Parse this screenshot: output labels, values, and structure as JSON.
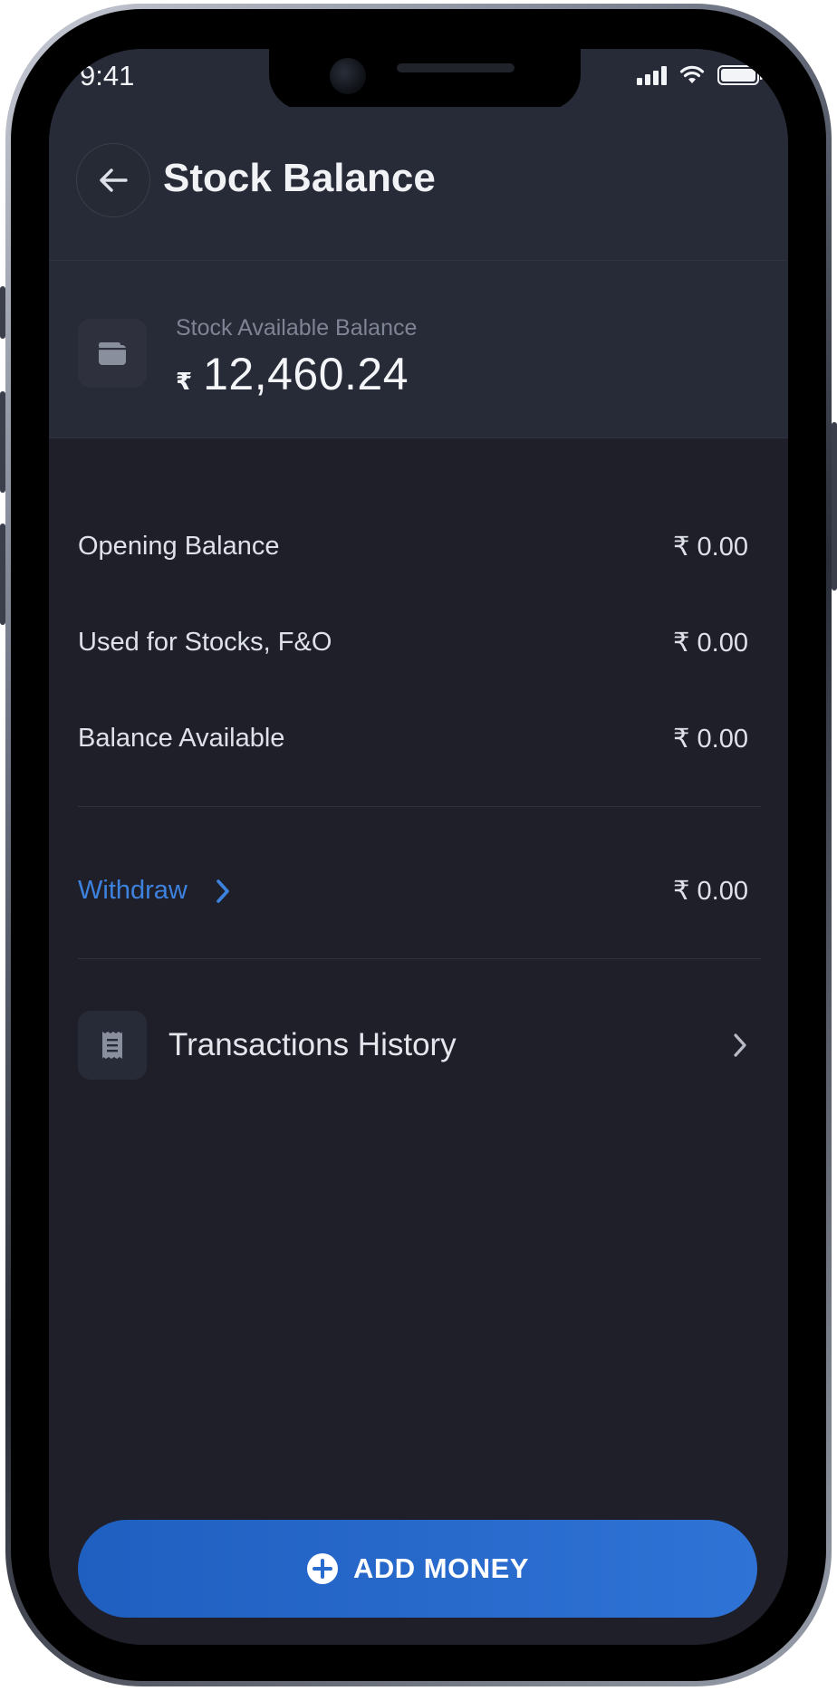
{
  "status_bar": {
    "time": "9:41"
  },
  "header": {
    "title": "Stock Balance"
  },
  "balance": {
    "label": "Stock Available Balance",
    "currency": "₹",
    "amount": "12,460.24"
  },
  "rows": [
    {
      "label": "Opening Balance",
      "value": "₹ 0.00"
    },
    {
      "label": "Used for Stocks, F&O",
      "value": "₹ 0.00"
    },
    {
      "label": "Balance Available",
      "value": "₹ 0.00"
    }
  ],
  "withdraw": {
    "label": "Withdraw",
    "value": "₹ 0.00"
  },
  "transactions": {
    "label": "Transactions History"
  },
  "cta": {
    "label": "ADD MONEY"
  },
  "colors": {
    "background": "#1f1f2a",
    "surface": "#272a37",
    "accent": "#2f73d6",
    "link": "#3d82de"
  },
  "icons": [
    "back-arrow-icon",
    "wallet-icon",
    "chevron-right-icon",
    "receipt-icon",
    "plus-circle-icon",
    "signal-icon",
    "wifi-icon",
    "battery-icon"
  ]
}
